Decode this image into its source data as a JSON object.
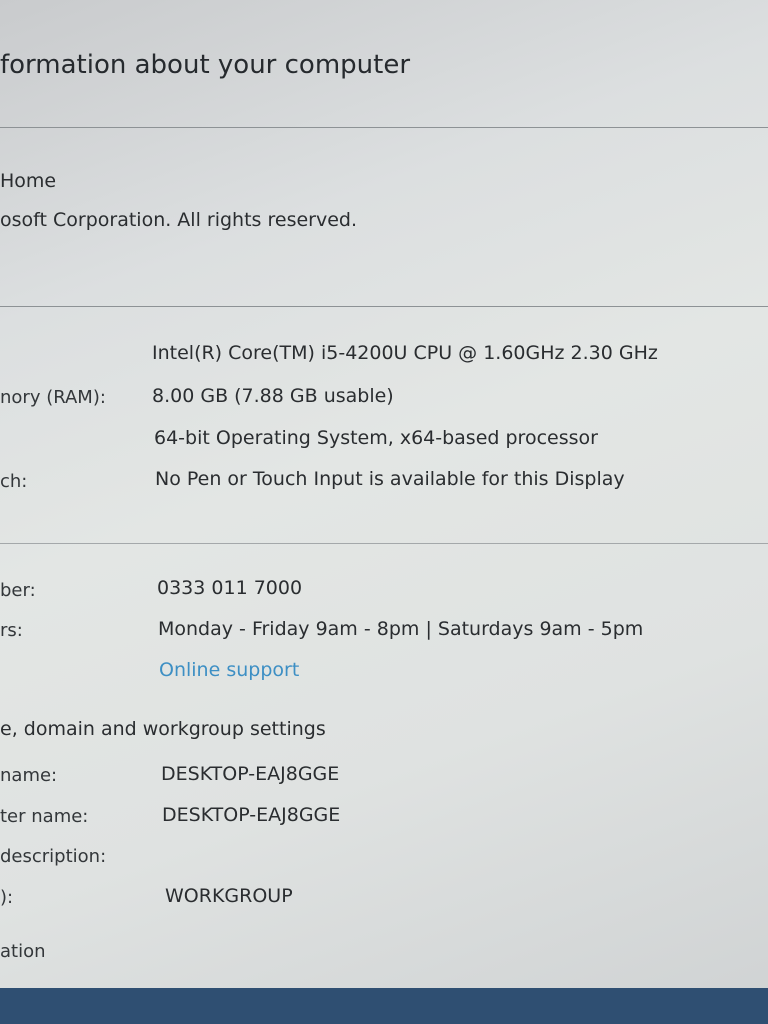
{
  "header": {
    "title": "formation about your computer"
  },
  "edition": {
    "name": "Home",
    "copyright": "osoft Corporation. All rights reserved."
  },
  "system": {
    "rows": [
      {
        "label": "",
        "value": "Intel(R) Core(TM) i5-4200U CPU @ 1.60GHz   2.30 GHz"
      },
      {
        "label": "nory (RAM):",
        "value": "8.00 GB (7.88 GB usable)"
      },
      {
        "label": "",
        "value": "64-bit Operating System, x64-based processor"
      },
      {
        "label": "ch:",
        "value": "No Pen or Touch Input is available for this Display"
      }
    ]
  },
  "support": {
    "phone_label": "ber:",
    "phone": "0333 011 7000",
    "hours_label": "rs:",
    "hours": "Monday - Friday 9am - 8pm | Saturdays 9am - 5pm",
    "link": "Online support"
  },
  "computer": {
    "heading": "e, domain and workgroup settings",
    "rows": [
      {
        "label": "name:",
        "value": "DESKTOP-EAJ8GGE"
      },
      {
        "label": "ter name:",
        "value": "DESKTOP-EAJ8GGE"
      },
      {
        "label": "description:",
        "value": ""
      },
      {
        "label": "):",
        "value": "WORKGROUP"
      }
    ]
  },
  "activation": {
    "heading": "ation"
  }
}
